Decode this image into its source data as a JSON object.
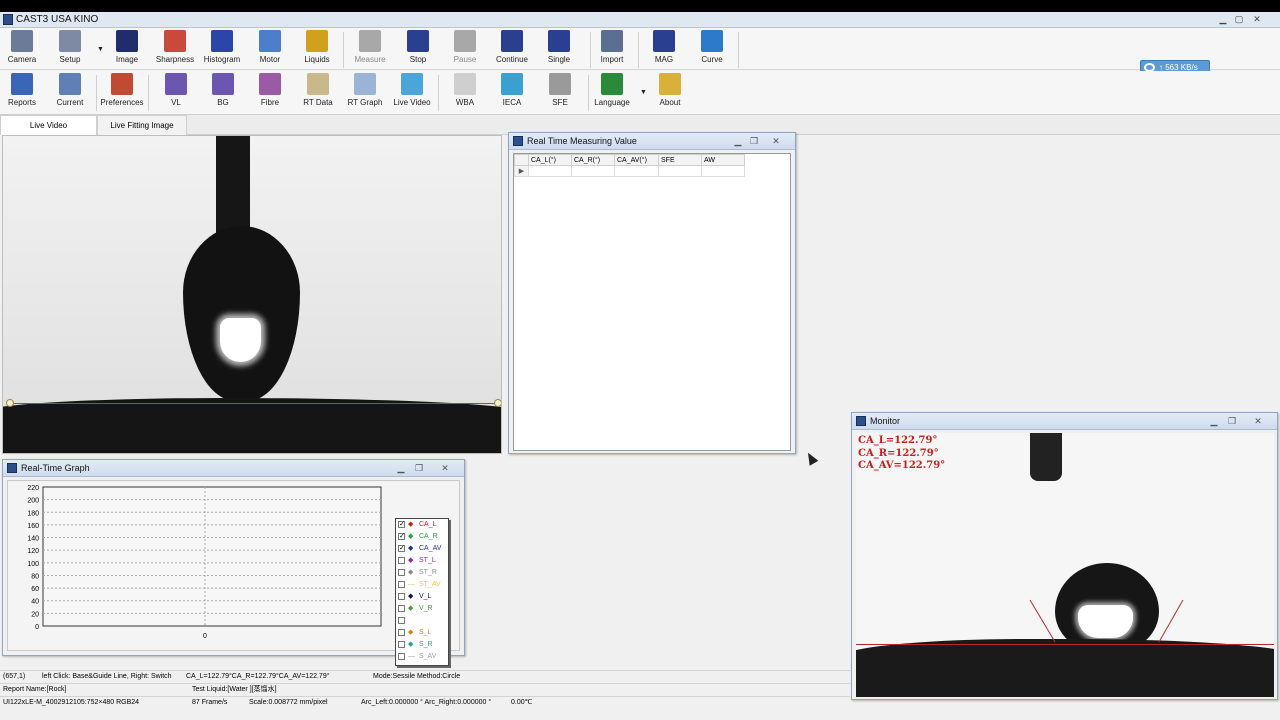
{
  "window": {
    "title": "CAST3  USA KINO"
  },
  "toolbar_row1": [
    {
      "label": "Camera",
      "icon": "camera-icon",
      "color": "#6b7c99"
    },
    {
      "label": "Setup",
      "icon": "camera-setup-icon",
      "color": "#7e8aa3"
    },
    {
      "label": "Image",
      "icon": "image-icon",
      "color": "#1f2d6d"
    },
    {
      "label": "Sharpness",
      "icon": "sharpness-icon",
      "color": "#c94a3a"
    },
    {
      "label": "Histogram",
      "icon": "histogram-icon",
      "color": "#2a47a8"
    },
    {
      "label": "Motor",
      "icon": "motor-gear-icon",
      "color": "#4c7ec9"
    },
    {
      "label": "Liquids",
      "icon": "liquids-icon",
      "color": "#d1a11e"
    },
    {
      "label": "Measure",
      "icon": "measure-icon",
      "color": "#a8a8a8",
      "disabled": true
    },
    {
      "label": "Stop",
      "icon": "stop-icon",
      "color": "#2a3f8f"
    },
    {
      "label": "Pause",
      "icon": "pause-icon",
      "color": "#a8a8a8",
      "disabled": true
    },
    {
      "label": "Continue",
      "icon": "continue-icon",
      "color": "#2a3f8f"
    },
    {
      "label": "Single",
      "icon": "single-icon",
      "color": "#2a3f8f"
    },
    {
      "label": "Import",
      "icon": "import-icon",
      "color": "#5b6f93"
    },
    {
      "label": "MAG",
      "icon": "mag-icon",
      "color": "#2a3f8f"
    },
    {
      "label": "Curve",
      "icon": "curve-icon",
      "color": "#2b7bc9"
    }
  ],
  "toolbar_row2": [
    {
      "label": "Reports",
      "icon": "reports-icon",
      "color": "#3a66b8"
    },
    {
      "label": "Current",
      "icon": "current-icon",
      "color": "#5f7fb6"
    },
    {
      "label": "Preferences",
      "icon": "preferences-icon",
      "color": "#c14a35"
    },
    {
      "label": "VL",
      "icon": "vl-icon",
      "color": "#6d56b0"
    },
    {
      "label": "BG",
      "icon": "bg-icon",
      "color": "#6d56b0"
    },
    {
      "label": "Fibre",
      "icon": "fibre-icon",
      "color": "#9a5aa6"
    },
    {
      "label": "RT Data",
      "icon": "rt-data-icon",
      "color": "#c9b98a"
    },
    {
      "label": "RT Graph",
      "icon": "rt-graph-icon",
      "color": "#9bb4d6"
    },
    {
      "label": "Live Video",
      "icon": "live-video-icon",
      "color": "#4aa6d8"
    },
    {
      "label": "WBA",
      "icon": "wba-icon",
      "color": "#cfcfcf"
    },
    {
      "label": "IECA",
      "icon": "ieca-icon",
      "color": "#3aa0d0"
    },
    {
      "label": "SFE",
      "icon": "sfe-icon",
      "color": "#9a9a9a"
    },
    {
      "label": "Language",
      "icon": "language-globe-icon",
      "color": "#2a8a3a"
    },
    {
      "label": "About",
      "icon": "about-icon",
      "color": "#d9b03a"
    }
  ],
  "net_speed": "↑ 563 KB/s",
  "tabs": [
    "Live Video",
    "Live Fitting Image"
  ],
  "rt_measuring": {
    "title": "Real Time Measuring Value",
    "columns": [
      "CA_L(°)",
      "CA_R(°)",
      "CA_AV(°)",
      "SFE",
      "AW"
    ],
    "row_marker": "▶"
  },
  "rt_graph": {
    "title": "Real-Time Graph",
    "legend": [
      {
        "name": "CA_L",
        "checked": true,
        "color": "#c02020",
        "marker": "◆"
      },
      {
        "name": "CA_R",
        "checked": true,
        "color": "#20a040",
        "marker": "◆"
      },
      {
        "name": "CA_AV",
        "checked": true,
        "color": "#2030a0",
        "marker": "◆"
      },
      {
        "name": "ST_L",
        "checked": false,
        "color": "#a020a0",
        "marker": "◆"
      },
      {
        "name": "ST_R",
        "checked": false,
        "color": "#8a8a8a",
        "marker": "◆"
      },
      {
        "name": "ST_AV",
        "checked": false,
        "color": "#e0d040",
        "marker": "—"
      },
      {
        "name": "V_L",
        "checked": false,
        "color": "#101060",
        "marker": "◆"
      },
      {
        "name": "V_R",
        "checked": false,
        "color": "#40a030",
        "marker": "◆"
      },
      {
        "name": "",
        "checked": false,
        "color": "#ffffff",
        "marker": ""
      },
      {
        "name": "S_L",
        "checked": false,
        "color": "#d08020",
        "marker": "◆"
      },
      {
        "name": "S_R",
        "checked": false,
        "color": "#20a0a0",
        "marker": "◆"
      },
      {
        "name": "S_AV",
        "checked": false,
        "color": "#a0a0a0",
        "marker": "—"
      }
    ]
  },
  "chart_data": {
    "type": "line",
    "title": "",
    "xlabel": "",
    "ylabel": "",
    "x_ticks": [
      "0"
    ],
    "yticks": [
      0,
      20,
      40,
      60,
      80,
      100,
      120,
      140,
      160,
      180,
      200,
      220
    ],
    "ylim": [
      0,
      220
    ],
    "grid": true,
    "legend_position": "right",
    "series": []
  },
  "monitor": {
    "title": "Monitor",
    "lines": [
      "CA_L=122.79°",
      "CA_R=122.79°",
      "CA_AV=122.79°"
    ]
  },
  "status": {
    "coords": "(657,1)",
    "hint": "left Click: Base&Guide Line, Right: Switch",
    "values": "CA_L=122.79°CA_R=122.79°CA_AV=122.79°",
    "mode": "Mode:Sessile  Method:Circle",
    "report": "Report Name:[Rock]",
    "liquid": "Test Liquid:[Water ][蒸馏水]",
    "camera": "UI122xLE-M_4002912105:752×480  RGB24",
    "fps": "87  Frame/s",
    "scale": "Scale:0.008772 mm/pixel",
    "arc": "Arc_Left:0.000000 °  Arc_Right:0.000000 °",
    "temp": "0.00℃"
  }
}
